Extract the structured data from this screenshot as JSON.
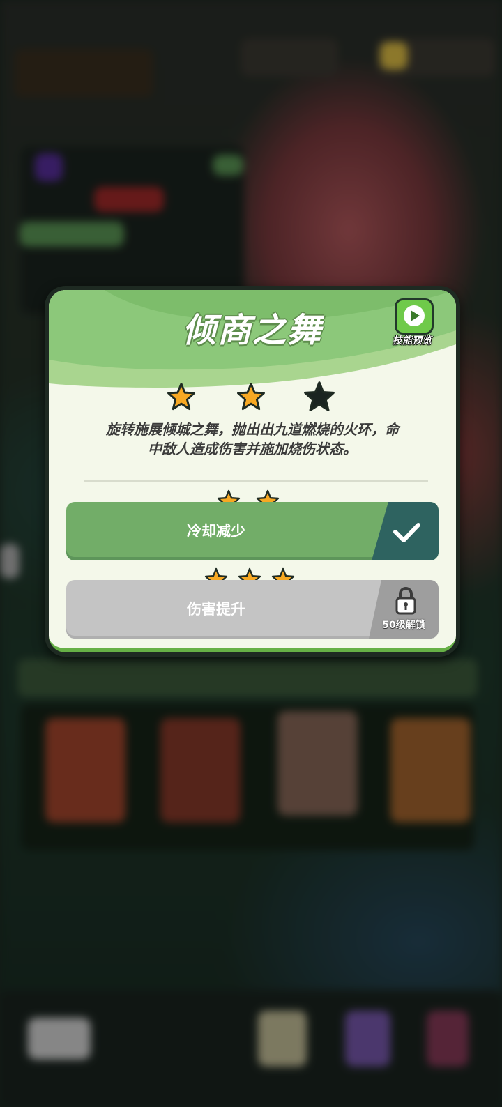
{
  "dialog": {
    "title": "倾商之舞",
    "preview_label": "技能预览",
    "rating": {
      "filled": 2,
      "total": 3
    },
    "description": "旋转施展倾城之舞，抛出出九道燃烧的火环，命中敌人造成伤害并施加烧伤状态。",
    "options": [
      {
        "label": "冷却减少",
        "stars": 2,
        "state": "selected",
        "badge_icon": "check-icon"
      },
      {
        "label": "伤害提升",
        "stars": 3,
        "state": "locked",
        "badge_icon": "lock-icon",
        "lock_text": "50级解锁"
      }
    ]
  },
  "colors": {
    "accent_green": "#72ad68",
    "header_green": "#8cc87a",
    "star_fill": "#f7a823",
    "star_empty": "#1a2420",
    "locked_gray": "#c4c4c4",
    "check_panel": "#2e6360"
  }
}
